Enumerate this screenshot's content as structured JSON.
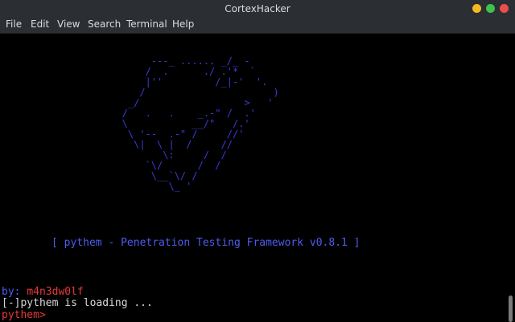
{
  "window": {
    "title": "CortexHacker",
    "buttons": [
      {
        "name": "minimize",
        "color": "#f5b922"
      },
      {
        "name": "maximize",
        "color": "#3fc14d"
      },
      {
        "name": "close",
        "color": "#ec4d4d"
      }
    ]
  },
  "menu": {
    "items": [
      "File",
      "Edit",
      "View",
      "Search",
      "Terminal",
      "Help"
    ]
  },
  "terminal": {
    "ascii_art": [
      "        ---_ ...... _/_ -",
      "       /  .      ./ .'*  `",
      "       |''         /_|-'  '.",
      "      /                      )",
      "    _/                  >   '",
      "   /   .   .    _.-\" /  .'",
      "   \\           __/\"   /.'",
      "    \\ '--  .-\" /     //'",
      "     \\|  \\ |  /     //",
      "          \\:     /  /",
      "       `\\/      /  /",
      "        \\__`\\/ /",
      "           \\_ '"
    ],
    "banner": "[ pythem - Penetration Testing Framework v0.8.1 ]",
    "by_label": "by:",
    "author": "m4n3dw0lf",
    "loading": "[-]pythem is loading ...",
    "prompt": "pythem>"
  },
  "colors": {
    "background": "#000000",
    "chrome": "#2b2e33",
    "ascii": "#3a3ad8",
    "banner": "#4e5cf0",
    "author": "#e83a3a",
    "text": "#d8d8d8"
  }
}
